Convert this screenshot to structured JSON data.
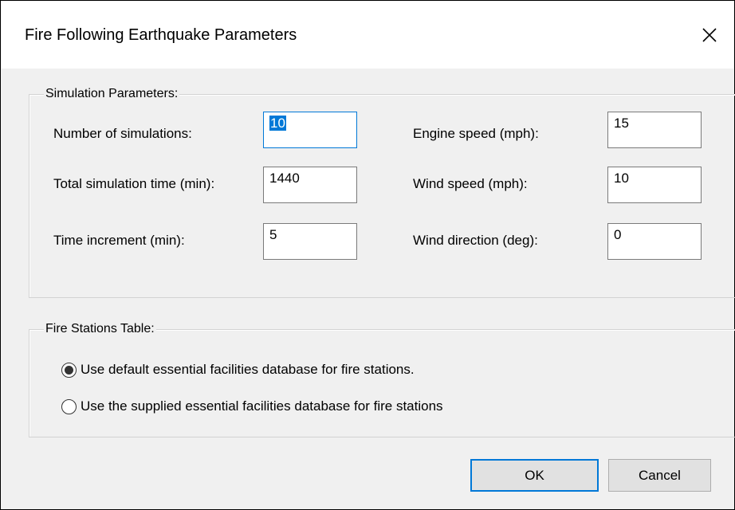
{
  "window": {
    "title": "Fire Following Earthquake Parameters",
    "close_icon": "close-icon"
  },
  "simulation": {
    "legend": "Simulation Parameters:",
    "fields": {
      "num_simulations": {
        "label": "Number of simulations:",
        "value": "10",
        "selected": true
      },
      "total_time": {
        "label": "Total simulation time (min):",
        "value": "1440"
      },
      "time_increment": {
        "label": "Time increment (min):",
        "value": "5"
      },
      "engine_speed": {
        "label": "Engine speed (mph):",
        "value": "15"
      },
      "wind_speed": {
        "label": "Wind speed (mph):",
        "value": "10"
      },
      "wind_direction": {
        "label": "Wind direction (deg):",
        "value": "0"
      }
    }
  },
  "stations": {
    "legend": "Fire Stations Table:",
    "options": [
      {
        "label": "Use default essential facilities database for fire stations.",
        "checked": true
      },
      {
        "label": "Use the supplied essential facilities database for fire stations",
        "checked": false
      }
    ]
  },
  "buttons": {
    "ok": "OK",
    "cancel": "Cancel"
  },
  "colors": {
    "accent": "#0078d7",
    "dialog_bg": "#f0f0f0"
  }
}
